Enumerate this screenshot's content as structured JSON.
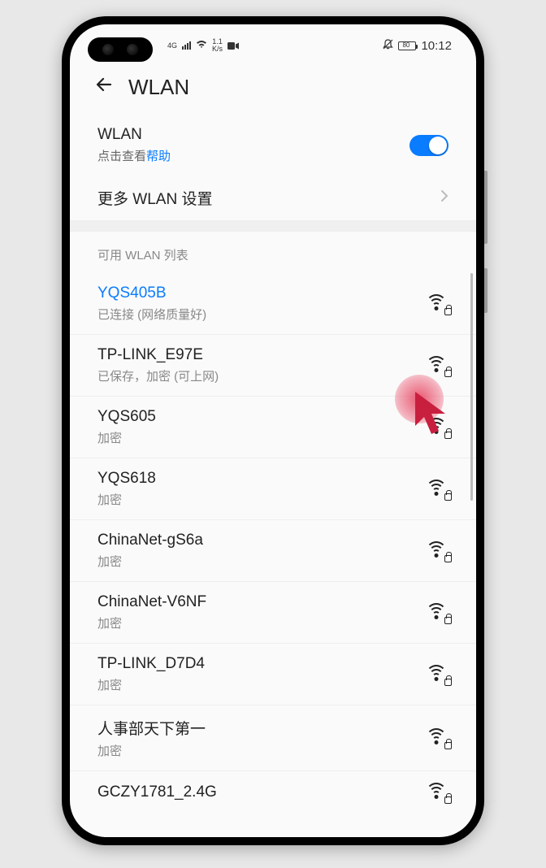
{
  "status_bar": {
    "network_gen": "4G",
    "speed_top": "1.1",
    "speed_bot": "K/s",
    "time": "10:12",
    "battery_text": "80"
  },
  "header": {
    "title": "WLAN"
  },
  "wlan_row": {
    "title": "WLAN",
    "sub_prefix": "点击查看",
    "sub_link": "帮助"
  },
  "more_settings": {
    "label": "更多 WLAN 设置"
  },
  "section_label": "可用 WLAN 列表",
  "networks": [
    {
      "name": "YQS405B",
      "status": "已连接 (网络质量好)",
      "connected": true
    },
    {
      "name": "TP-LINK_E97E",
      "status": "已保存，加密 (可上网)",
      "connected": false
    },
    {
      "name": "YQS605",
      "status": "加密",
      "connected": false
    },
    {
      "name": "YQS618",
      "status": "加密",
      "connected": false
    },
    {
      "name": "ChinaNet-gS6a",
      "status": "加密",
      "connected": false
    },
    {
      "name": "ChinaNet-V6NF",
      "status": "加密",
      "connected": false
    },
    {
      "name": "TP-LINK_D7D4",
      "status": "加密",
      "connected": false
    },
    {
      "name": "人事部天下第一",
      "status": "加密",
      "connected": false
    },
    {
      "name": "GCZY1781_2.4G",
      "status": "",
      "connected": false
    }
  ]
}
